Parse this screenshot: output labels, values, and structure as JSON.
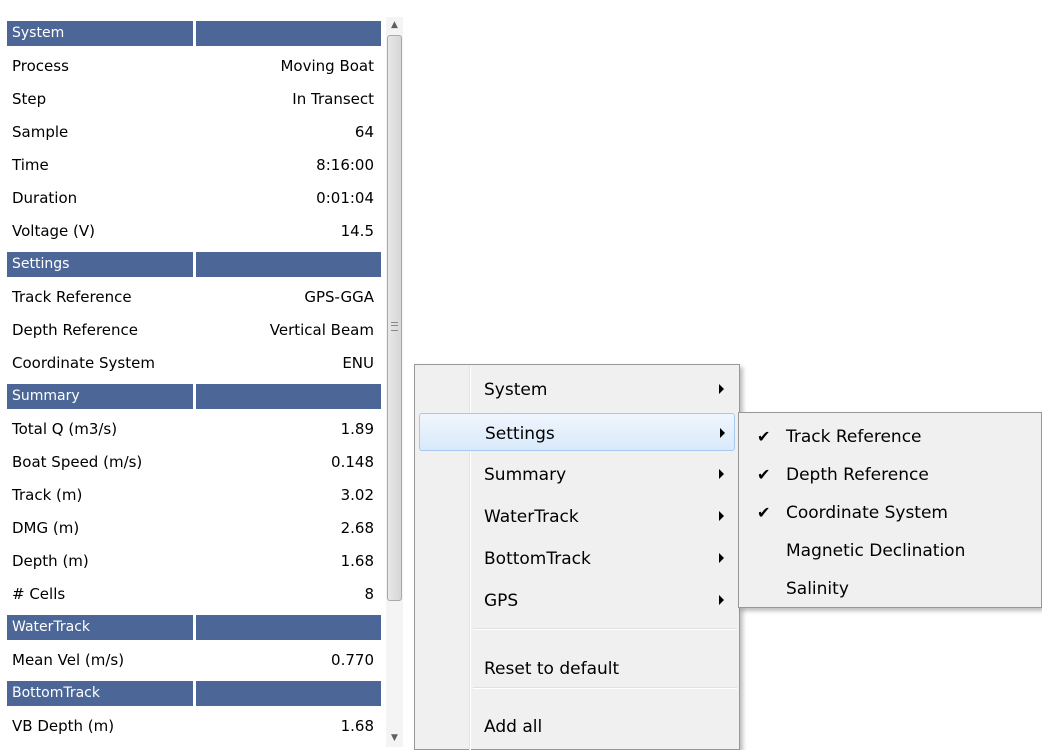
{
  "grid": {
    "rows": [
      {
        "type": "category",
        "label": "System"
      },
      {
        "type": "property",
        "label": "Process",
        "value": "Moving Boat"
      },
      {
        "type": "property",
        "label": "Step",
        "value": "In Transect"
      },
      {
        "type": "property",
        "label": "Sample",
        "value": "64"
      },
      {
        "type": "property",
        "label": "Time",
        "value": "8:16:00"
      },
      {
        "type": "property",
        "label": "Duration",
        "value": "0:01:04"
      },
      {
        "type": "property",
        "label": "Voltage (V)",
        "value": "14.5"
      },
      {
        "type": "category",
        "label": "Settings"
      },
      {
        "type": "property",
        "label": "Track Reference",
        "value": "GPS-GGA"
      },
      {
        "type": "property",
        "label": "Depth Reference",
        "value": "Vertical Beam"
      },
      {
        "type": "property",
        "label": "Coordinate System",
        "value": "ENU"
      },
      {
        "type": "category",
        "label": "Summary"
      },
      {
        "type": "property",
        "label": "Total Q (m3/s)",
        "value": "1.89"
      },
      {
        "type": "property",
        "label": "Boat Speed (m/s)",
        "value": "0.148"
      },
      {
        "type": "property",
        "label": "Track (m)",
        "value": "3.02"
      },
      {
        "type": "property",
        "label": "DMG (m)",
        "value": "2.68"
      },
      {
        "type": "property",
        "label": "Depth (m)",
        "value": "1.68"
      },
      {
        "type": "property",
        "label": "# Cells",
        "value": "8"
      },
      {
        "type": "category",
        "label": "WaterTrack"
      },
      {
        "type": "property",
        "label": "Mean Vel (m/s)",
        "value": "0.770"
      },
      {
        "type": "category",
        "label": "BottomTrack"
      },
      {
        "type": "property",
        "label": "VB Depth (m)",
        "value": "1.68"
      }
    ],
    "category_color": "#4c6797"
  },
  "scrollbar": {
    "up_icon": "scroll-up-arrow-icon",
    "down_icon": "scroll-down-arrow-icon"
  },
  "context_menu": {
    "items": [
      {
        "label": "System",
        "has_submenu": true,
        "highlighted": false
      },
      {
        "label": "Settings",
        "has_submenu": true,
        "highlighted": true
      },
      {
        "label": "Summary",
        "has_submenu": true,
        "highlighted": false
      },
      {
        "label": "WaterTrack",
        "has_submenu": true,
        "highlighted": false
      },
      {
        "label": "BottomTrack",
        "has_submenu": true,
        "highlighted": false
      },
      {
        "label": "GPS",
        "has_submenu": true,
        "highlighted": false
      },
      {
        "label": "Reset to default",
        "has_submenu": false,
        "highlighted": false
      },
      {
        "label": "Add all",
        "has_submenu": false,
        "highlighted": false
      }
    ],
    "highlight_color": "#d9e9fb"
  },
  "submenu": {
    "items": [
      {
        "label": "Track Reference",
        "checked": true
      },
      {
        "label": "Depth Reference",
        "checked": true
      },
      {
        "label": "Coordinate System",
        "checked": true
      },
      {
        "label": "Magnetic Declination",
        "checked": false
      },
      {
        "label": "Salinity",
        "checked": false
      }
    ],
    "check_glyph": "✔"
  }
}
